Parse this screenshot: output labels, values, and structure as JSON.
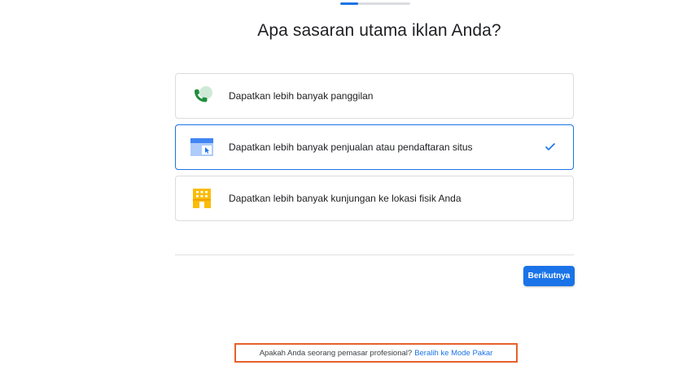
{
  "progress": {
    "value": 0.25
  },
  "heading": "Apa sasaran utama iklan Anda?",
  "options": [
    {
      "label": "Dapatkan lebih banyak panggilan",
      "icon": "phone-icon",
      "selected": false
    },
    {
      "label": "Dapatkan lebih banyak penjualan atau pendaftaran situs",
      "icon": "website-icon",
      "selected": true
    },
    {
      "label": "Dapatkan lebih banyak kunjungan ke lokasi fisik Anda",
      "icon": "storefront-icon",
      "selected": false
    }
  ],
  "next_button": {
    "label": "Berikutnya"
  },
  "pro_prompt": {
    "text": "Apakah Anda seorang pemasar profesional?",
    "link": "Beralih ke Mode Pakar"
  },
  "colors": {
    "accent": "#1a73e8",
    "highlight_border": "#e8602c",
    "phone_green": "#1e8e3e",
    "store_yellow": "#fbbc04"
  }
}
